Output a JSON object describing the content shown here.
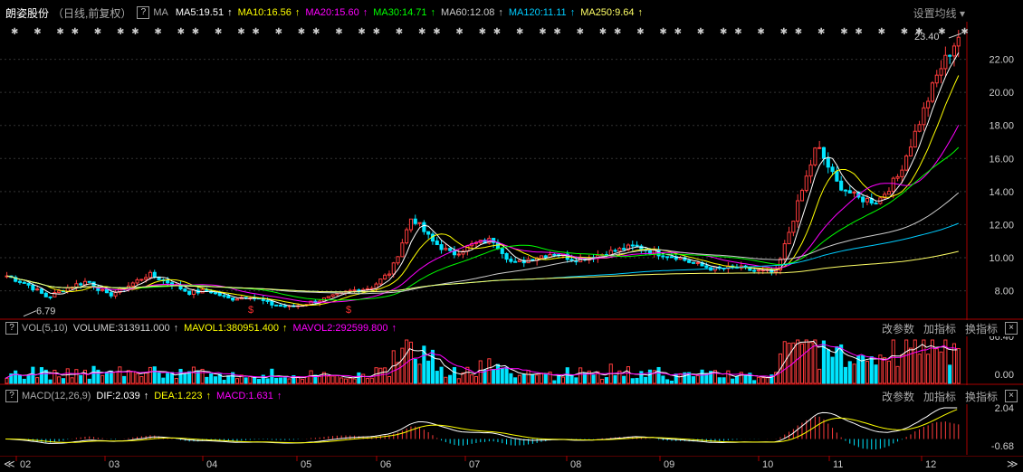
{
  "header": {
    "stock_name": "朗姿股份",
    "period": "（日线,前复权）",
    "help": "?",
    "ma_label": "MA",
    "indicators": [
      {
        "text": "MA5:19.51",
        "color": "#ffffff"
      },
      {
        "text": "MA10:16.56",
        "color": "#ffff00"
      },
      {
        "text": "MA20:15.60",
        "color": "#ff00ff"
      },
      {
        "text": "MA30:14.71",
        "color": "#00ff00"
      },
      {
        "text": "MA60:12.08",
        "color": "#cccccc"
      },
      {
        "text": "MA120:11.11",
        "color": "#00ccff"
      },
      {
        "text": "MA250:9.64",
        "color": "#ffff66"
      }
    ],
    "settings_label": "设置均线 ▾"
  },
  "price_axis": [
    "22.00",
    "20.00",
    "18.00",
    "16.00",
    "14.00",
    "12.00",
    "10.00",
    "8.00"
  ],
  "annotations": {
    "high_label": "23.40",
    "low_label": "6.79",
    "s_marker": "$"
  },
  "vol_panel": {
    "help": "?",
    "name": "VOL(5,10)",
    "values": [
      {
        "text": "VOLUME:313911.000",
        "color": "#cccccc"
      },
      {
        "text": "MAVOL1:380951.400",
        "color": "#ffff00"
      },
      {
        "text": "MAVOL2:292599.800",
        "color": "#ff00ff"
      }
    ],
    "buttons": [
      "改参数",
      "加指标",
      "换指标"
    ],
    "close": "×",
    "axis": [
      "66.40",
      "0.00"
    ]
  },
  "macd_panel": {
    "help": "?",
    "name": "MACD(12,26,9)",
    "values": [
      {
        "text": "DIF:2.039",
        "color": "#ffffff"
      },
      {
        "text": "DEA:1.223",
        "color": "#ffff00"
      },
      {
        "text": "MACD:1.631",
        "color": "#ff00ff"
      }
    ],
    "buttons": [
      "改参数",
      "加指标",
      "换指标"
    ],
    "close": "×",
    "axis": [
      "2.04",
      "-0.68"
    ]
  },
  "time_axis": [
    "02",
    "03",
    "04",
    "05",
    "06",
    "07",
    "08",
    "09",
    "10",
    "11",
    "12"
  ],
  "nav": {
    "left": "≪",
    "right": "≫"
  },
  "chart_data": {
    "type": "candlestick",
    "months": [
      "02",
      "03",
      "04",
      "05",
      "06",
      "07",
      "08",
      "09",
      "10",
      "11",
      "12"
    ],
    "close_approx": [
      8.9,
      8.4,
      7.6,
      8.2,
      8.6,
      7.7,
      8.3,
      9.0,
      8.5,
      7.9,
      8.0,
      7.5,
      7.7,
      7.2,
      7.0,
      7.3,
      7.6,
      8.0,
      8.2,
      9.2,
      12.5,
      11.0,
      10.2,
      10.8,
      11.1,
      9.6,
      10.0,
      10.3,
      9.9,
      10.1,
      10.4,
      10.7,
      10.3,
      10.1,
      9.6,
      9.3,
      9.4,
      9.2,
      9.1,
      13.0,
      16.8,
      14.5,
      13.6,
      13.4,
      14.9,
      18.0,
      21.2,
      23.4
    ],
    "ylim": [
      6.5,
      24
    ],
    "high": 23.4,
    "low": 6.79,
    "volume_ylim": [
      0,
      66.4
    ],
    "macd_ylim": [
      -0.68,
      2.04
    ]
  }
}
